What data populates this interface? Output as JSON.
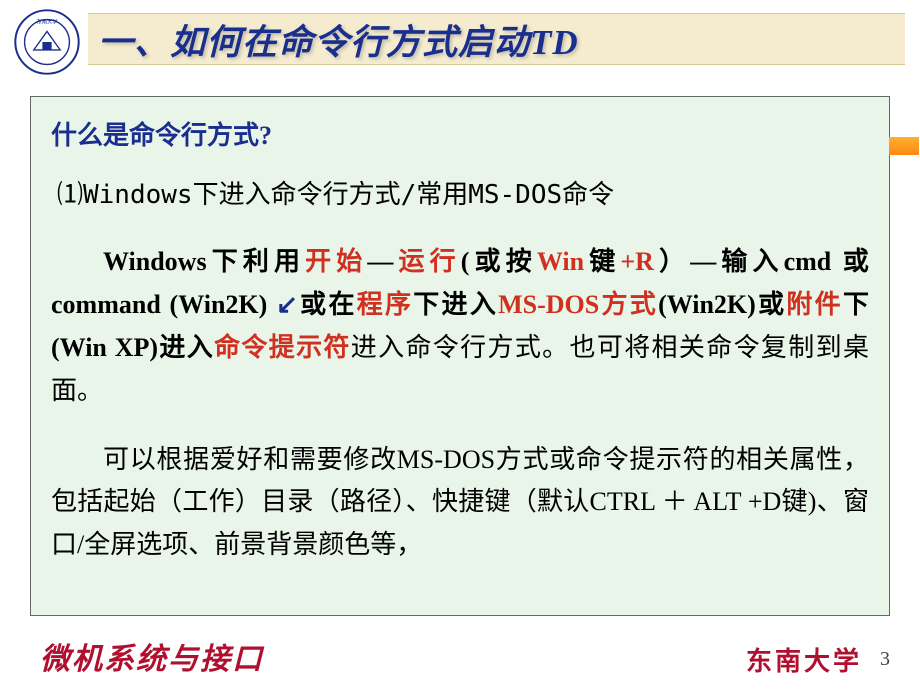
{
  "header": {
    "title": "一、如何在命令行方式启动TD"
  },
  "content": {
    "question": "什么是命令行方式?",
    "subheading": "⑴Windows下进入命令行方式/常用MS-DOS命令",
    "p1": {
      "t1": "Windows",
      "t2": "下利用",
      "t3": "开始",
      "t4": "—",
      "t5": "运行",
      "t6": "(",
      "t7": "或按",
      "t8": "Win",
      "t9": "键",
      "t10": "+R",
      "t11": "）",
      "t12": "—输入",
      "t13": "cmd ",
      "t14": "或",
      "t15": "command  (Win2K) ",
      "arrow": "↙",
      "t16": "或在",
      "t17": "程序",
      "t18": "下进入",
      "t19": "MS-DOS",
      "t20": "方式",
      "t21": "(Win2K)",
      "t22": "或",
      "t23": "附件",
      "t24": "下",
      "t25": "(Win  XP)",
      "t26": "进入",
      "t27": "命令提示符",
      "t28": "进入命令行方式。也可将相关命令复制到桌面。"
    },
    "p2": "可以根据爱好和需要修改MS-DOS方式或命令提示符的相关属性，包括起始（工作）目录（路径）、快捷键（默认CTRL ＋ ALT +D键)、窗口/全屏选项、前景背景颜色等，"
  },
  "footer": {
    "course": "微机系统与接口",
    "university": "东南大学",
    "page": "3"
  }
}
